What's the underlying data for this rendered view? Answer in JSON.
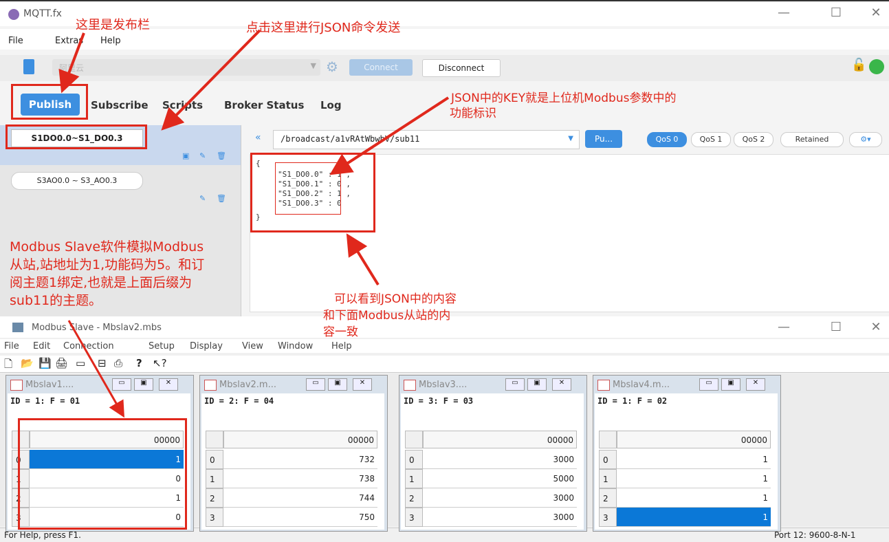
{
  "mqtt": {
    "title": "MQTT.fx",
    "menu": [
      "File",
      "Extras",
      "Help"
    ],
    "profile_placeholder": "阿里云",
    "connect_label": "Connect",
    "disconnect_label": "Disconnect",
    "tabs": [
      "Publish",
      "Subscribe",
      "Scripts",
      "Broker Status",
      "Log"
    ],
    "topics": [
      "S1DO0.0~S1_DO0.3",
      "S3AO0.0 ~ S3_AO0.3"
    ],
    "topic_path": "/broadcast/a1vRAtWbwbV/sub11",
    "publish_label": "Pu...",
    "qos": [
      "QoS 0",
      "QoS 1",
      "QoS 2"
    ],
    "retained_label": "Retained",
    "payload_lines": [
      "{",
      "\"S1_DO0.0\" : 1 ,",
      "\"S1_DO0.1\" : 0 ,",
      "\"S1_DO0.2\" : 1 ,",
      "\"S1_DO0.3\" : 0",
      "}"
    ]
  },
  "modbus": {
    "title": "Modbus Slave - Mbslav2.mbs",
    "menu": [
      "File",
      "Edit",
      "Connection",
      "Setup",
      "Display",
      "View",
      "Window",
      "Help"
    ],
    "status_left": "For Help, press F1.",
    "status_right": "Port 12: 9600-8-N-1",
    "windows": [
      {
        "title": "Mbslav1....",
        "id_line": "ID = 1: F = 01",
        "header": "00000",
        "rows": [
          "0",
          "1",
          "2",
          "3"
        ],
        "values": [
          "1",
          "0",
          "1",
          "0"
        ]
      },
      {
        "title": "Mbslav2.m...",
        "id_line": "ID = 2: F = 04",
        "header": "00000",
        "rows": [
          "0",
          "1",
          "2",
          "3"
        ],
        "values": [
          "732",
          "738",
          "744",
          "750"
        ]
      },
      {
        "title": "Mbslav3....",
        "id_line": "ID = 3: F = 03",
        "header": "00000",
        "rows": [
          "0",
          "1",
          "2",
          "3"
        ],
        "values": [
          "3000",
          "5000",
          "3000",
          "3000"
        ]
      },
      {
        "title": "Mbslav4.m...",
        "id_line": "ID = 1: F = 02",
        "header": "00000",
        "rows": [
          "0",
          "1",
          "2",
          "3"
        ],
        "values": [
          "1",
          "1",
          "1",
          "1"
        ]
      }
    ]
  },
  "annotations": {
    "publish_bar": "这里是发布栏",
    "click_send": "点击这里进行JSON命令发送",
    "json_key_1": "JSON中的KEY就是上位机Modbus参数中的",
    "json_key_2": "功能标识",
    "modbus_note": [
      "Modbus Slave软件模拟Modbus",
      "从站,站地址为1,功能码为5。和订",
      "阅主题1绑定,也就是上面后缀为",
      "sub11的主题。"
    ],
    "consistent": [
      "可以看到JSON中的内容",
      "和下面Modbus从站的内",
      "容一致"
    ]
  },
  "colors": {
    "accent": "#3d8fe0",
    "annotation": "#e0281c",
    "selection": "#0b78d7",
    "connected": "#3ab64a"
  }
}
